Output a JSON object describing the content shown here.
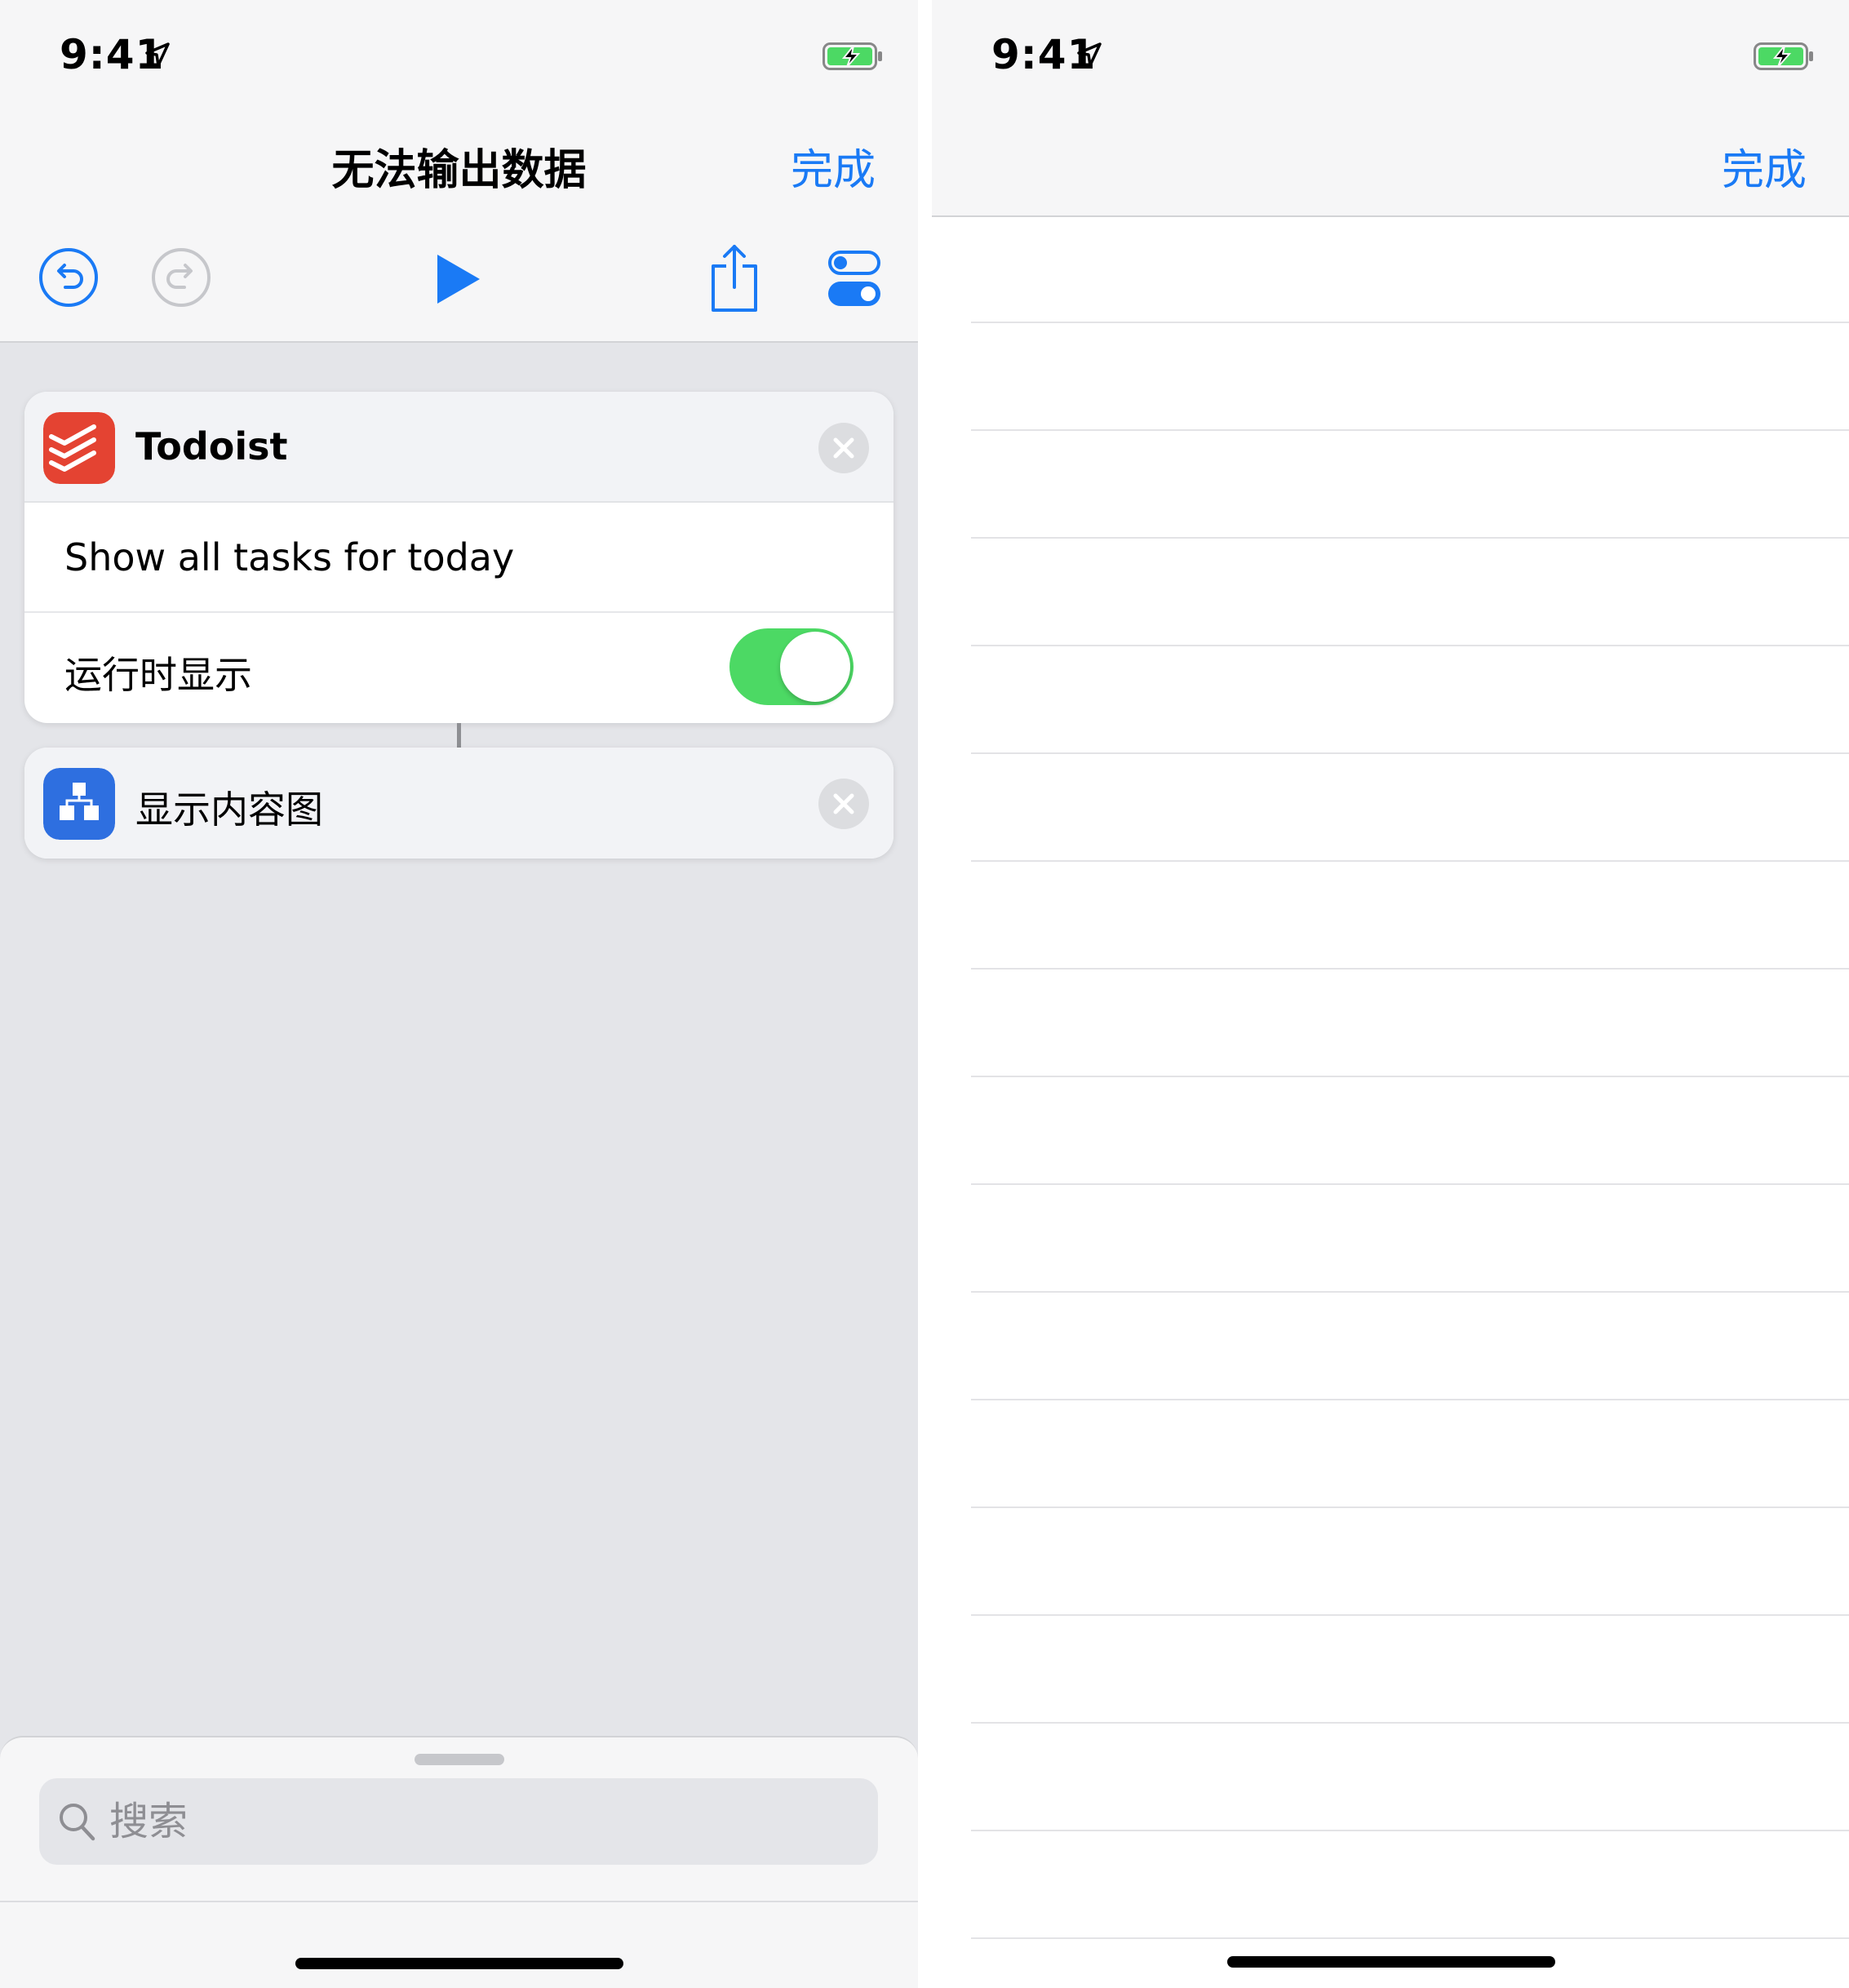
{
  "left": {
    "status": {
      "time": "9:41"
    },
    "title": "无法输出数据",
    "done_label": "完成",
    "toolbar": {
      "undo": "undo-icon",
      "redo": "redo-icon",
      "run": "play-icon",
      "share": "share-icon",
      "settings": "toggles-icon"
    },
    "actions": [
      {
        "app": "Todoist",
        "icon": "todoist-icon",
        "task": "Show all tasks for today",
        "option_label": "运行时显示",
        "option_on": true
      },
      {
        "app": "显示内容图",
        "icon": "content-graph-icon"
      }
    ],
    "search": {
      "placeholder": "搜索"
    }
  },
  "right": {
    "status": {
      "time": "9:41"
    },
    "done_label": "完成",
    "empty_rows": 16
  },
  "colors": {
    "accent": "#1a7af5",
    "toggle_on": "#4cd964",
    "todoist_red": "#e44332",
    "graph_blue": "#2e6fe0",
    "battery_green": "#4cd964"
  }
}
